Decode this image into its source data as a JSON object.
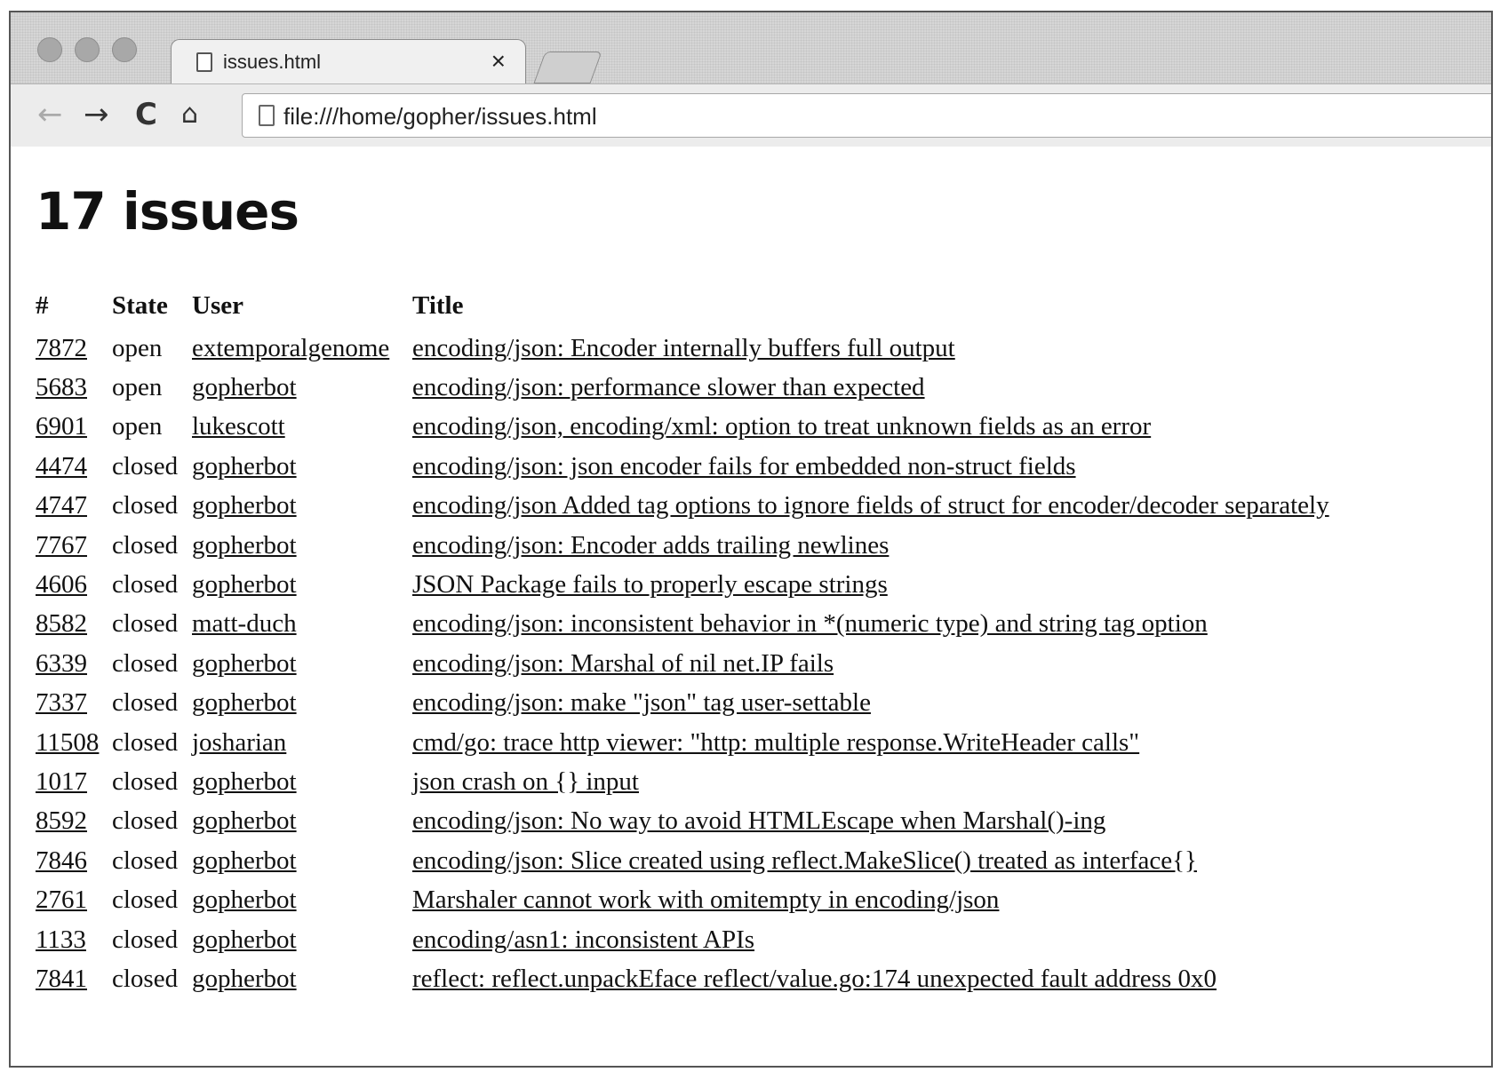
{
  "browser": {
    "tab_title": "issues.html",
    "tab_close": "×",
    "url": "file:///home/gopher/issues.html"
  },
  "page": {
    "heading": "17 issues",
    "columns": {
      "num": "#",
      "state": "State",
      "user": "User",
      "title": "Title"
    },
    "issues": [
      {
        "num": "7872",
        "state": "open",
        "user": "extemporalgenome",
        "title": "encoding/json: Encoder internally buffers full output"
      },
      {
        "num": "5683",
        "state": "open",
        "user": "gopherbot",
        "title": "encoding/json: performance slower than expected"
      },
      {
        "num": "6901",
        "state": "open",
        "user": "lukescott",
        "title": "encoding/json, encoding/xml: option to treat unknown fields as an error"
      },
      {
        "num": "4474",
        "state": "closed",
        "user": "gopherbot",
        "title": "encoding/json: json encoder fails for embedded non-struct fields"
      },
      {
        "num": "4747",
        "state": "closed",
        "user": "gopherbot",
        "title": "encoding/json Added tag options to ignore fields of struct for encoder/decoder separately"
      },
      {
        "num": "7767",
        "state": "closed",
        "user": "gopherbot",
        "title": "encoding/json: Encoder adds trailing newlines"
      },
      {
        "num": "4606",
        "state": "closed",
        "user": "gopherbot",
        "title": "JSON Package fails to properly escape strings"
      },
      {
        "num": "8582",
        "state": "closed",
        "user": "matt-duch",
        "title": "encoding/json: inconsistent behavior in *(numeric type) and string tag option"
      },
      {
        "num": "6339",
        "state": "closed",
        "user": "gopherbot",
        "title": "encoding/json: Marshal of nil net.IP fails"
      },
      {
        "num": "7337",
        "state": "closed",
        "user": "gopherbot",
        "title": "encoding/json: make \"json\" tag user-settable"
      },
      {
        "num": "11508",
        "state": "closed",
        "user": "josharian",
        "title": "cmd/go: trace http viewer: \"http: multiple response.WriteHeader calls\""
      },
      {
        "num": "1017",
        "state": "closed",
        "user": "gopherbot",
        "title": "json crash on {} input"
      },
      {
        "num": "8592",
        "state": "closed",
        "user": "gopherbot",
        "title": "encoding/json: No way to avoid HTMLEscape when Marshal()-ing"
      },
      {
        "num": "7846",
        "state": "closed",
        "user": "gopherbot",
        "title": "encoding/json: Slice created using reflect.MakeSlice() treated as interface{}"
      },
      {
        "num": "2761",
        "state": "closed",
        "user": "gopherbot",
        "title": "Marshaler cannot work with omitempty in encoding/json"
      },
      {
        "num": "1133",
        "state": "closed",
        "user": "gopherbot",
        "title": "encoding/asn1: inconsistent APIs"
      },
      {
        "num": "7841",
        "state": "closed",
        "user": "gopherbot",
        "title": "reflect: reflect.unpackEface reflect/value.go:174 unexpected fault address 0x0"
      }
    ]
  }
}
